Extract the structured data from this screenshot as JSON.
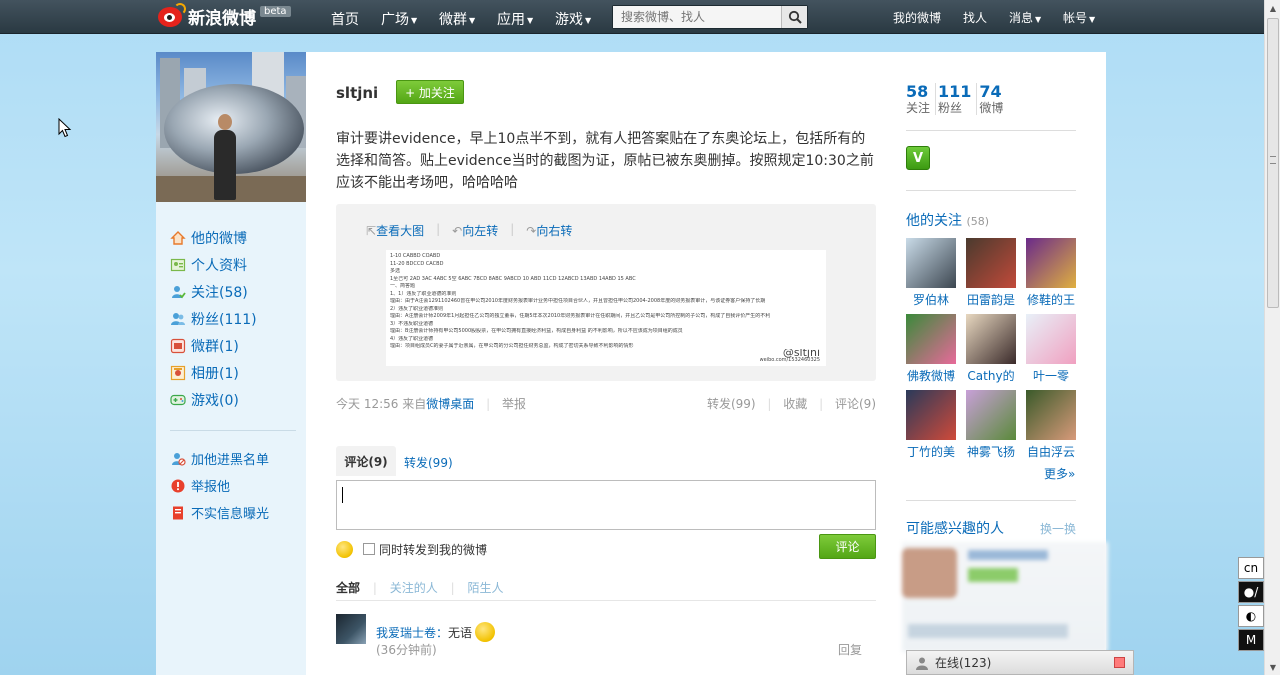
{
  "topbar": {
    "logo_text": "新浪微博",
    "beta": "beta",
    "nav": [
      {
        "label": "首页",
        "caret": false
      },
      {
        "label": "广场",
        "caret": true
      },
      {
        "label": "微群",
        "caret": true
      },
      {
        "label": "应用",
        "caret": true
      },
      {
        "label": "游戏",
        "caret": true
      }
    ],
    "search_placeholder": "搜索微博、找人",
    "right_nav": [
      {
        "label": "我的微博",
        "caret": false
      },
      {
        "label": "找人",
        "caret": false
      },
      {
        "label": "消息",
        "caret": true
      },
      {
        "label": "帐号",
        "caret": true
      }
    ]
  },
  "left": {
    "menu": [
      {
        "label": "他的微博",
        "icon": "home-icon",
        "color": "#e7792b"
      },
      {
        "label": "个人资料",
        "icon": "profile-icon",
        "color": "#7ab84a"
      },
      {
        "label": "关注(58)",
        "icon": "follow-icon",
        "color": "#4aa0d8"
      },
      {
        "label": "粉丝(111)",
        "icon": "fans-icon",
        "color": "#4aa0d8"
      },
      {
        "label": "微群(1)",
        "icon": "group-icon",
        "color": "#d8503a"
      },
      {
        "label": "相册(1)",
        "icon": "album-icon",
        "color": "#e7a02b"
      },
      {
        "label": "游戏(0)",
        "icon": "game-icon",
        "color": "#3aa84a"
      }
    ],
    "actions": [
      {
        "label": "加他进黑名单",
        "icon": "blacklist-icon"
      },
      {
        "label": "举报他",
        "icon": "report-icon"
      },
      {
        "label": "不实信息曝光",
        "icon": "expose-icon"
      }
    ]
  },
  "main": {
    "username": "sltjni",
    "follow_label": "+ 加关注",
    "post_text": "审计要讲evidence，早上10点半不到，就有人把答案贴在了东奥论坛上，包括所有的选择和简答。贴上evidence当时的截图为证，原帖已被东奥删掉。按照规定10:30之前应该不能出考场吧，哈哈哈哈",
    "media_tools": [
      "查看大图",
      "向左转",
      "向右转"
    ],
    "image_lines": [
      "1-10 CABBD COABD",
      "11-20 BDCCD CACBD",
      "多选",
      "1至己可 2AD 3AC 4ABC 5空 6ABC 7BCD 8ABC 9ABCD 10 ABD 11CD 12ABCD 13ABD 14ABD 15 ABC",
      "一、简答题",
      "1、1）违反了职业道德的准则",
      "理由：由于A注会1291102460曾在甲公司2010年度财务报表审计业务中担任项目合伙人，并且曾担任甲公司2004-2008年度的财务报表审计，与该证券客户保持了长期",
      "2）违反了职业道德准则",
      "理由：A注册会计师2009年1月起担任乙公司的独立董事，任期5年本次2010年财务报表审计在任职期间，并且乙公司是甲公司所控制的子公司，构成了自我评价产生的不利",
      "3）不违反职业道德",
      "理由：B注册会计师持有甲公司5000股股票，在甲公司拥有直接经济利益，构成自身利益 的不利影响，所以不应该成为项目组的成员",
      "4）违反了职业道德",
      "理由：项目组成员C的妻子属于近亲属，在甲公司的分公司担任财务总监，构成了密切关系导致不利影响的情形"
    ],
    "image_watermark": "weibo.com/1532460325",
    "image_watermark_handle": "@sltjni",
    "time": "今天 12:56",
    "from_prefix": "来自",
    "source": "微博桌面",
    "report": "举报",
    "repost": "转发(99)",
    "favorite": "收藏",
    "comment": "评论(9)",
    "tab_comment": "评论(9)",
    "tab_repost": "转发(99)",
    "also_repost": "同时转发到我的微博",
    "submit": "评论",
    "filters": [
      "全部",
      "关注的人",
      "陌生人"
    ],
    "comments": [
      {
        "name": "我爱瑞士卷",
        "text": "无语",
        "time": "(36分钟前)",
        "reply": "回复"
      }
    ]
  },
  "right": {
    "stats": [
      {
        "num": "58",
        "label": "关注"
      },
      {
        "num": "111",
        "label": "粉丝"
      },
      {
        "num": "74",
        "label": "微博"
      }
    ],
    "badge": "V",
    "following_title": "他的关注",
    "following_count": "(58)",
    "following": [
      {
        "name": "罗伯林",
        "c1": "#c9dbe8",
        "c2": "#3c4650"
      },
      {
        "name": "田雷韵是",
        "c1": "#4a3a2e",
        "c2": "#c24a3a"
      },
      {
        "name": "修鞋的王",
        "c1": "#6a2a8a",
        "c2": "#e0b040"
      },
      {
        "name": "佛教微博",
        "c1": "#3a8a3a",
        "c2": "#e86a9a"
      },
      {
        "name": "Cathy的",
        "c1": "#e8d8c0",
        "c2": "#3a2a2a"
      },
      {
        "name": "叶一零",
        "c1": "#e8f0f8",
        "c2": "#f0a0c0"
      },
      {
        "name": "丁竹的美",
        "c1": "#2a3a5a",
        "c2": "#d04a3a"
      },
      {
        "name": "神雾飞扬",
        "c1": "#c8a0d8",
        "c2": "#5a8a3a"
      },
      {
        "name": "自由浮云",
        "c1": "#3a5a2a",
        "c2": "#d89a7a"
      }
    ],
    "more": "更多»",
    "maybe_title": "可能感兴趣的人",
    "swap": "换一换"
  },
  "online": {
    "label": "在线(123)"
  },
  "floatbar": [
    "cn",
    "●/",
    "◐",
    "M"
  ]
}
